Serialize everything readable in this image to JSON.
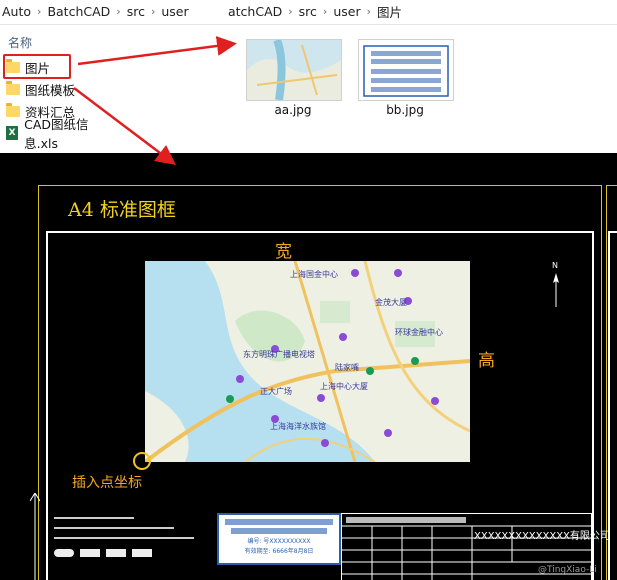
{
  "left_breadcrumb": [
    "Auto",
    "BatchCAD",
    "src",
    "user"
  ],
  "right_breadcrumb": [
    "atchCAD",
    "src",
    "user",
    "图片"
  ],
  "column_header": "名称",
  "files": [
    {
      "name": "图片",
      "icon": "folder-icon"
    },
    {
      "name": "图纸模板",
      "icon": "folder-icon"
    },
    {
      "name": "资料汇总",
      "icon": "folder-icon"
    },
    {
      "name": "CAD图纸信息.xls",
      "icon": "excel-file-icon"
    }
  ],
  "thumbnails": [
    {
      "name": "aa.jpg"
    },
    {
      "name": "bb.jpg"
    }
  ],
  "cad": {
    "frame_title": "A4 标准图框",
    "width_label": "宽",
    "height_label": "高",
    "insert_label": "插入点坐标",
    "north_label": "N",
    "company": "XXXXXXXXXXXXXX有限公司",
    "stamp_line1": "编号: 号XXXXXXXXXX",
    "stamp_line2": "有效期至: 6666年8月8日",
    "map_labels": [
      "上海国金中心",
      "东方明珠广播电视塔",
      "陆家嘴",
      "正大广场",
      "金茂大厦",
      "上海中心大厦",
      "环球金融中心",
      "上海海洋水族馆"
    ]
  },
  "watermark": "@TingXiao-Li",
  "colors": {
    "accent_yellow": "#f2d21e",
    "accent_orange": "#f5a623",
    "highlight_red": "#e02020"
  }
}
